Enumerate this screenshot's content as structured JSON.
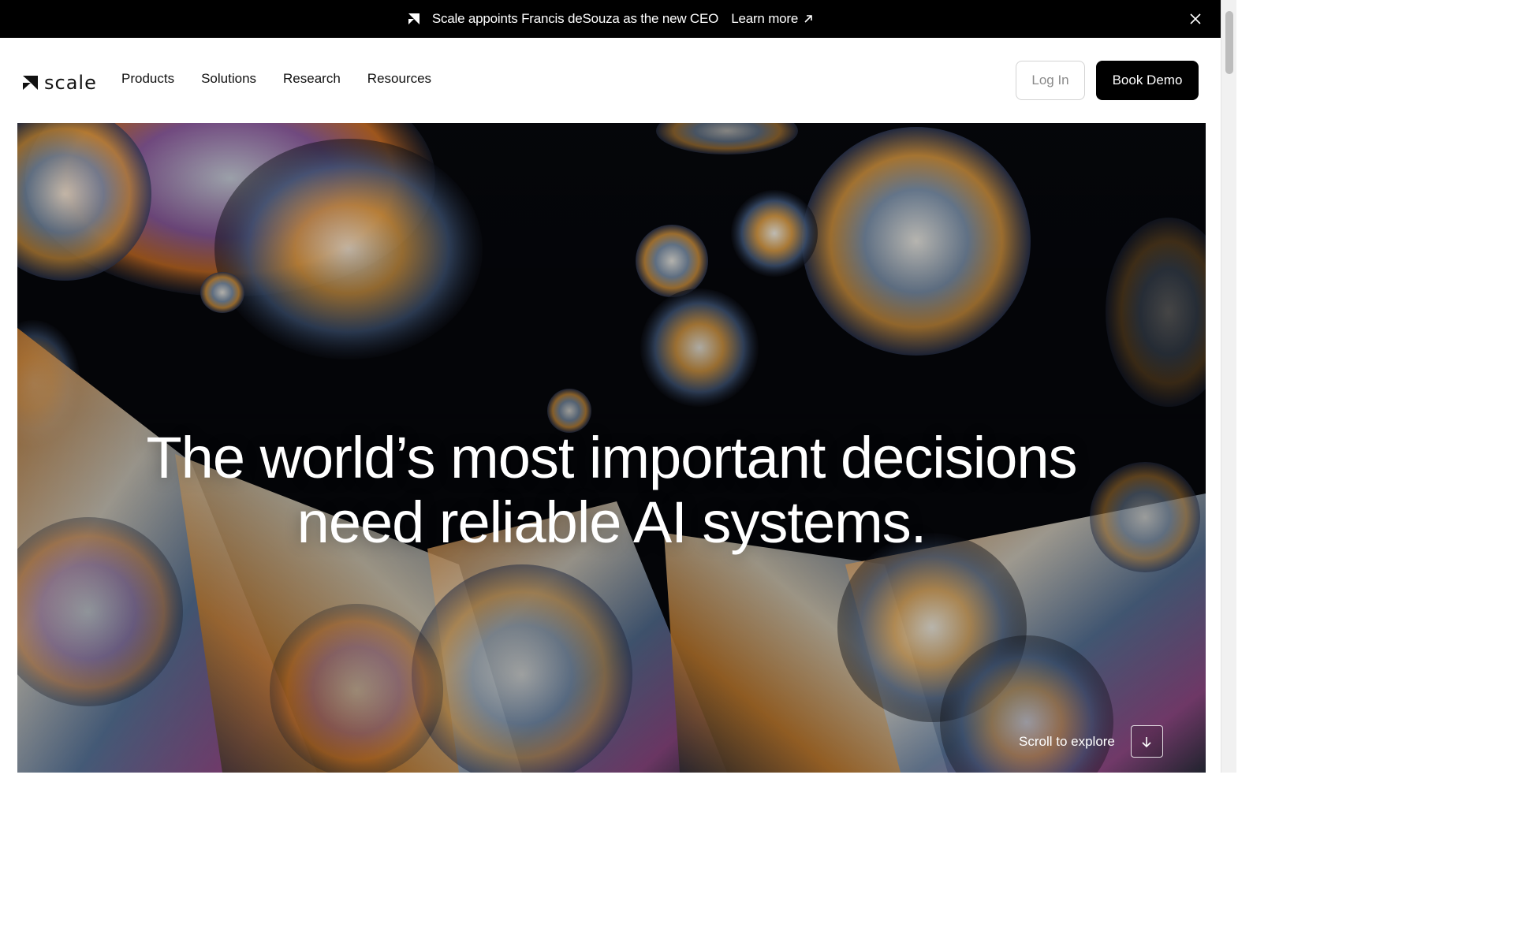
{
  "announcement": {
    "text": "Scale appoints Francis deSouza as the new CEO",
    "link_label": "Learn more"
  },
  "header": {
    "brand": "scale",
    "nav": [
      "Products",
      "Solutions",
      "Research",
      "Resources"
    ],
    "login_label": "Log In",
    "demo_label": "Book Demo"
  },
  "hero": {
    "headline_line1": "The world’s most important decisions",
    "headline_line2": "need reliable AI systems.",
    "scroll_label": "Scroll to explore"
  },
  "colors": {
    "bar": "#000000",
    "demo_button": "#000000",
    "page": "#ffffff"
  },
  "icons": [
    "scale-logo-icon",
    "arrow-up-right-icon",
    "close-icon",
    "arrow-down-icon"
  ]
}
